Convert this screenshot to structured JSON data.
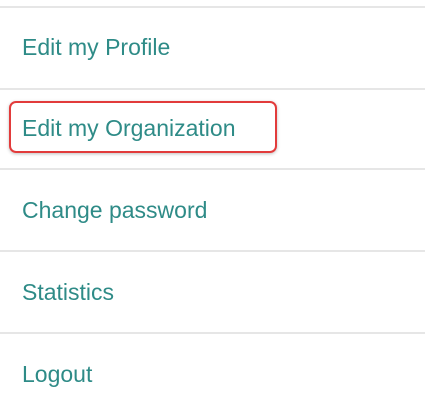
{
  "menu": {
    "items": [
      {
        "label": "Edit my Profile"
      },
      {
        "label": "Edit my Organization"
      },
      {
        "label": "Change password"
      },
      {
        "label": "Statistics"
      },
      {
        "label": "Logout"
      }
    ]
  },
  "colors": {
    "link": "#2e8b87",
    "highlight": "#e23b3b",
    "divider": "#e6e6e6"
  }
}
